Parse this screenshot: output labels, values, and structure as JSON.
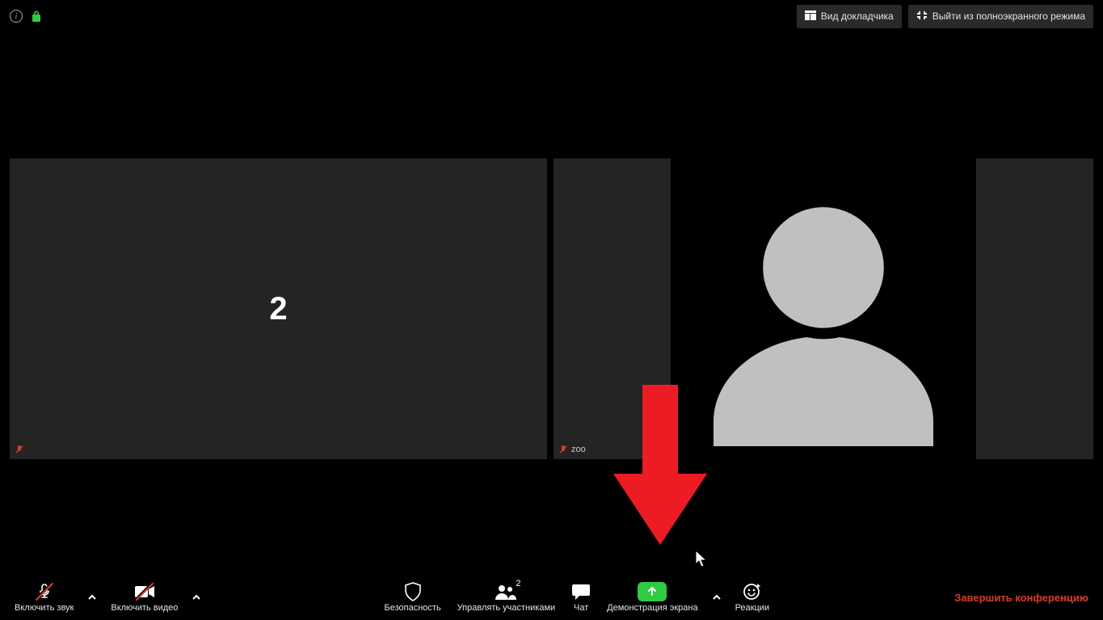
{
  "top": {
    "speaker_view_label": "Вид докладчика",
    "exit_fullscreen_label": "Выйти из полноэкранного режима"
  },
  "tiles": {
    "left_number": "2",
    "right_name": "zoo"
  },
  "toolbar": {
    "mute_label": "Включить звук",
    "video_label": "Включить видео",
    "security_label": "Безопасность",
    "participants_label": "Управлять участниками",
    "participants_count": "2",
    "chat_label": "Чат",
    "share_label": "Демонстрация экрана",
    "reactions_label": "Реакции",
    "end_label": "Завершить конференцию"
  }
}
